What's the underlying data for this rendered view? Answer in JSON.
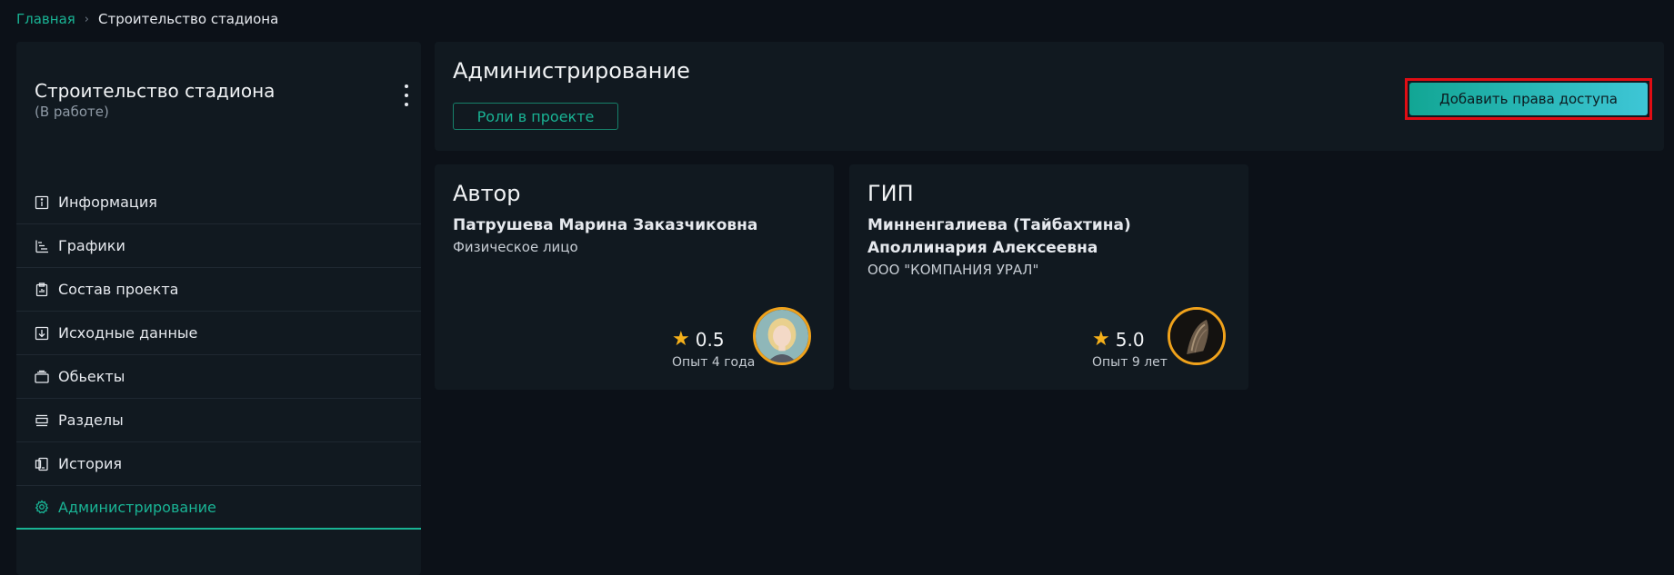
{
  "breadcrumb": {
    "home": "Главная",
    "separator": "›",
    "current": "Строительство стадиона"
  },
  "project": {
    "title": "Строительство стадиона",
    "status": "(В работе)",
    "menu_icon": "kebab-menu-icon"
  },
  "nav": {
    "items": [
      {
        "label": "Информация",
        "icon": "info-icon"
      },
      {
        "label": "Графики",
        "icon": "gantt-icon"
      },
      {
        "label": "Состав проекта",
        "icon": "clipboard-icon"
      },
      {
        "label": "Исходные данные",
        "icon": "download-icon"
      },
      {
        "label": "Обьекты",
        "icon": "folder-icon"
      },
      {
        "label": "Разделы",
        "icon": "sections-icon"
      },
      {
        "label": "История",
        "icon": "history-icon"
      },
      {
        "label": "Администрирование",
        "icon": "gear-icon",
        "active": true
      }
    ]
  },
  "admin": {
    "title": "Администрирование",
    "roles_button": "Роли в проекте",
    "add_button": "Добавить права доступа"
  },
  "cards": [
    {
      "role": "Автор",
      "name": "Патрушева Марина Заказчиковна",
      "org": "Физическое лицо",
      "rating": "0.5",
      "experience": "Опыт 4 года"
    },
    {
      "role": "ГИП",
      "name": "Минненгалиева (Тайбахтина) Аполлинария Алексеевна",
      "org": "ООО \"КОМПАНИЯ УРАЛ\"",
      "rating": "5.0",
      "experience": "Опыт 9 лет"
    }
  ],
  "colors": {
    "accent": "#19b394",
    "background": "#0c1118",
    "panel": "#111920",
    "star": "#f5b01a",
    "highlight_border": "#e00d14"
  }
}
